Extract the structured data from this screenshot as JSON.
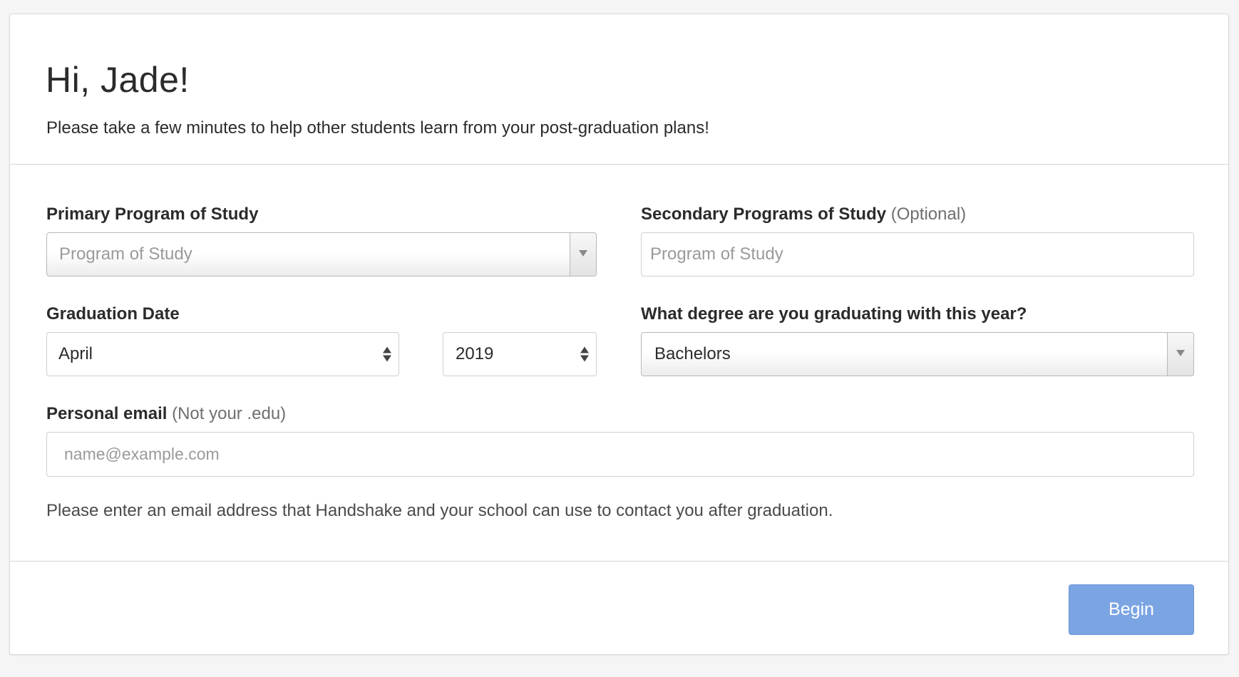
{
  "header": {
    "greeting": "Hi, Jade!",
    "intro": "Please take a few minutes to help other students learn from your post-graduation plans!"
  },
  "form": {
    "primary_program": {
      "label": "Primary Program of Study",
      "placeholder": "Program of Study",
      "icon": "chevron-down-icon"
    },
    "secondary_programs": {
      "label": "Secondary Programs of Study",
      "label_note": "(Optional)",
      "placeholder": "Program of Study"
    },
    "graduation_date": {
      "label": "Graduation Date",
      "month_value": "April",
      "year_value": "2019",
      "icon": "updown-stepper-icon"
    },
    "degree": {
      "label": "What degree are you graduating with this year?",
      "value": "Bachelors",
      "icon": "chevron-down-icon"
    },
    "personal_email": {
      "label": "Personal email",
      "label_note": "(Not your .edu)",
      "placeholder": "name@example.com",
      "help_text": "Please enter an email address that Handshake and your school can use to contact you after graduation."
    }
  },
  "footer": {
    "begin_label": "Begin"
  },
  "colors": {
    "accent_button": "#7ba4e3",
    "background": "#f5f5f5",
    "card": "#ffffff"
  }
}
